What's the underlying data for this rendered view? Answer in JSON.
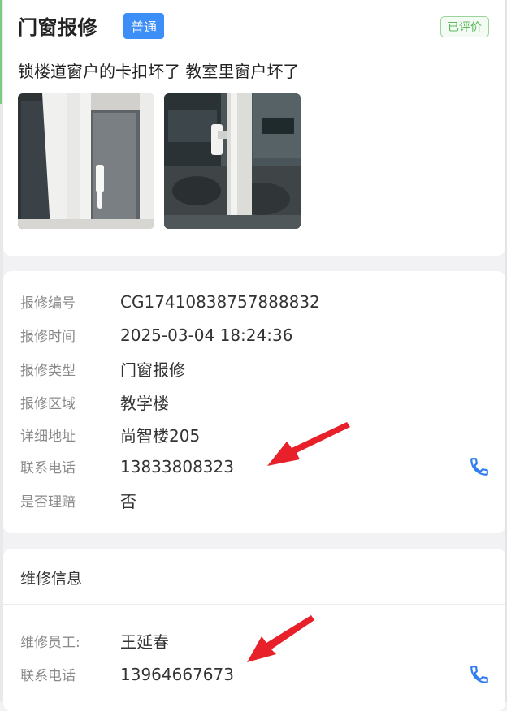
{
  "header": {
    "title": "门窗报修",
    "level_badge": "普通",
    "status_badge": "已评价",
    "description": "锁楼道窗户的卡扣坏了 教室里窗户坏了",
    "photos": [
      {
        "name": "window-photo-1"
      },
      {
        "name": "window-photo-2"
      }
    ]
  },
  "detail": {
    "rows": [
      {
        "label": "报修编号",
        "value": "CG17410838757888832"
      },
      {
        "label": "报修时间",
        "value": "2025-03-04 18:24:36"
      },
      {
        "label": "报修类型",
        "value": "门窗报修"
      },
      {
        "label": "报修区域",
        "value": "教学楼"
      },
      {
        "label": "详细地址",
        "value": "尚智楼205"
      },
      {
        "label": "联系电话",
        "value": "13833808323"
      },
      {
        "label": "是否理赔",
        "value": "否"
      }
    ]
  },
  "repair": {
    "title": "维修信息",
    "rows": [
      {
        "label": "维修员工:",
        "value": "王延春"
      },
      {
        "label": "联系电话",
        "value": "13964667673"
      }
    ]
  },
  "colors": {
    "accent": "#3e8ef7",
    "status_green": "#5bb85b",
    "arrow_red": "#e8202a",
    "phone_blue": "#2f7bf0"
  },
  "icons": {
    "phone": "phone-icon",
    "arrow": "red-arrow-annotation"
  }
}
